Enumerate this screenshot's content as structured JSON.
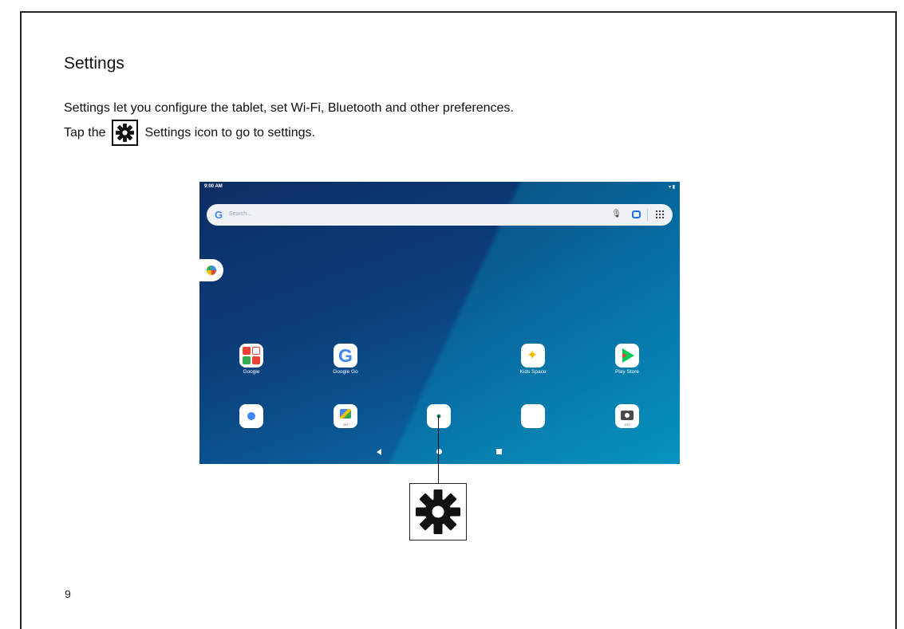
{
  "heading": "Settings",
  "paragraph_1": "Settings let you configure the tablet, set Wi-Fi, Bluetooth and other preferences.",
  "paragraph_2_before": "Tap the",
  "paragraph_2_after": "Settings icon to go to settings.",
  "page_number": "9",
  "tablet": {
    "status_time": "9:00 AM",
    "status_icons": "▾ ▮",
    "search_placeholder": "Search...",
    "search_logo": "G",
    "home_apps": [
      {
        "label": "Google",
        "icon": "google-folder-icon"
      },
      {
        "label": "Google Go",
        "icon": "google-go-icon"
      },
      {
        "label": "Kids Space",
        "icon": "kids-space-icon"
      },
      {
        "label": "Play Store",
        "icon": "play-store-icon"
      }
    ],
    "dock_apps": [
      {
        "icon": "chrome-icon",
        "badge": ""
      },
      {
        "icon": "gallery-go-icon",
        "badge": "GO"
      },
      {
        "icon": "settings-icon",
        "badge": ""
      },
      {
        "icon": "youtube-music-icon",
        "badge": ""
      },
      {
        "icon": "camera-go-icon",
        "badge": "GO"
      }
    ],
    "colors": {
      "settings_icon_bg": "#127a5e",
      "wallpaper_top": "#0d2d63",
      "wallpaper_bottom": "#0b7fae"
    }
  }
}
